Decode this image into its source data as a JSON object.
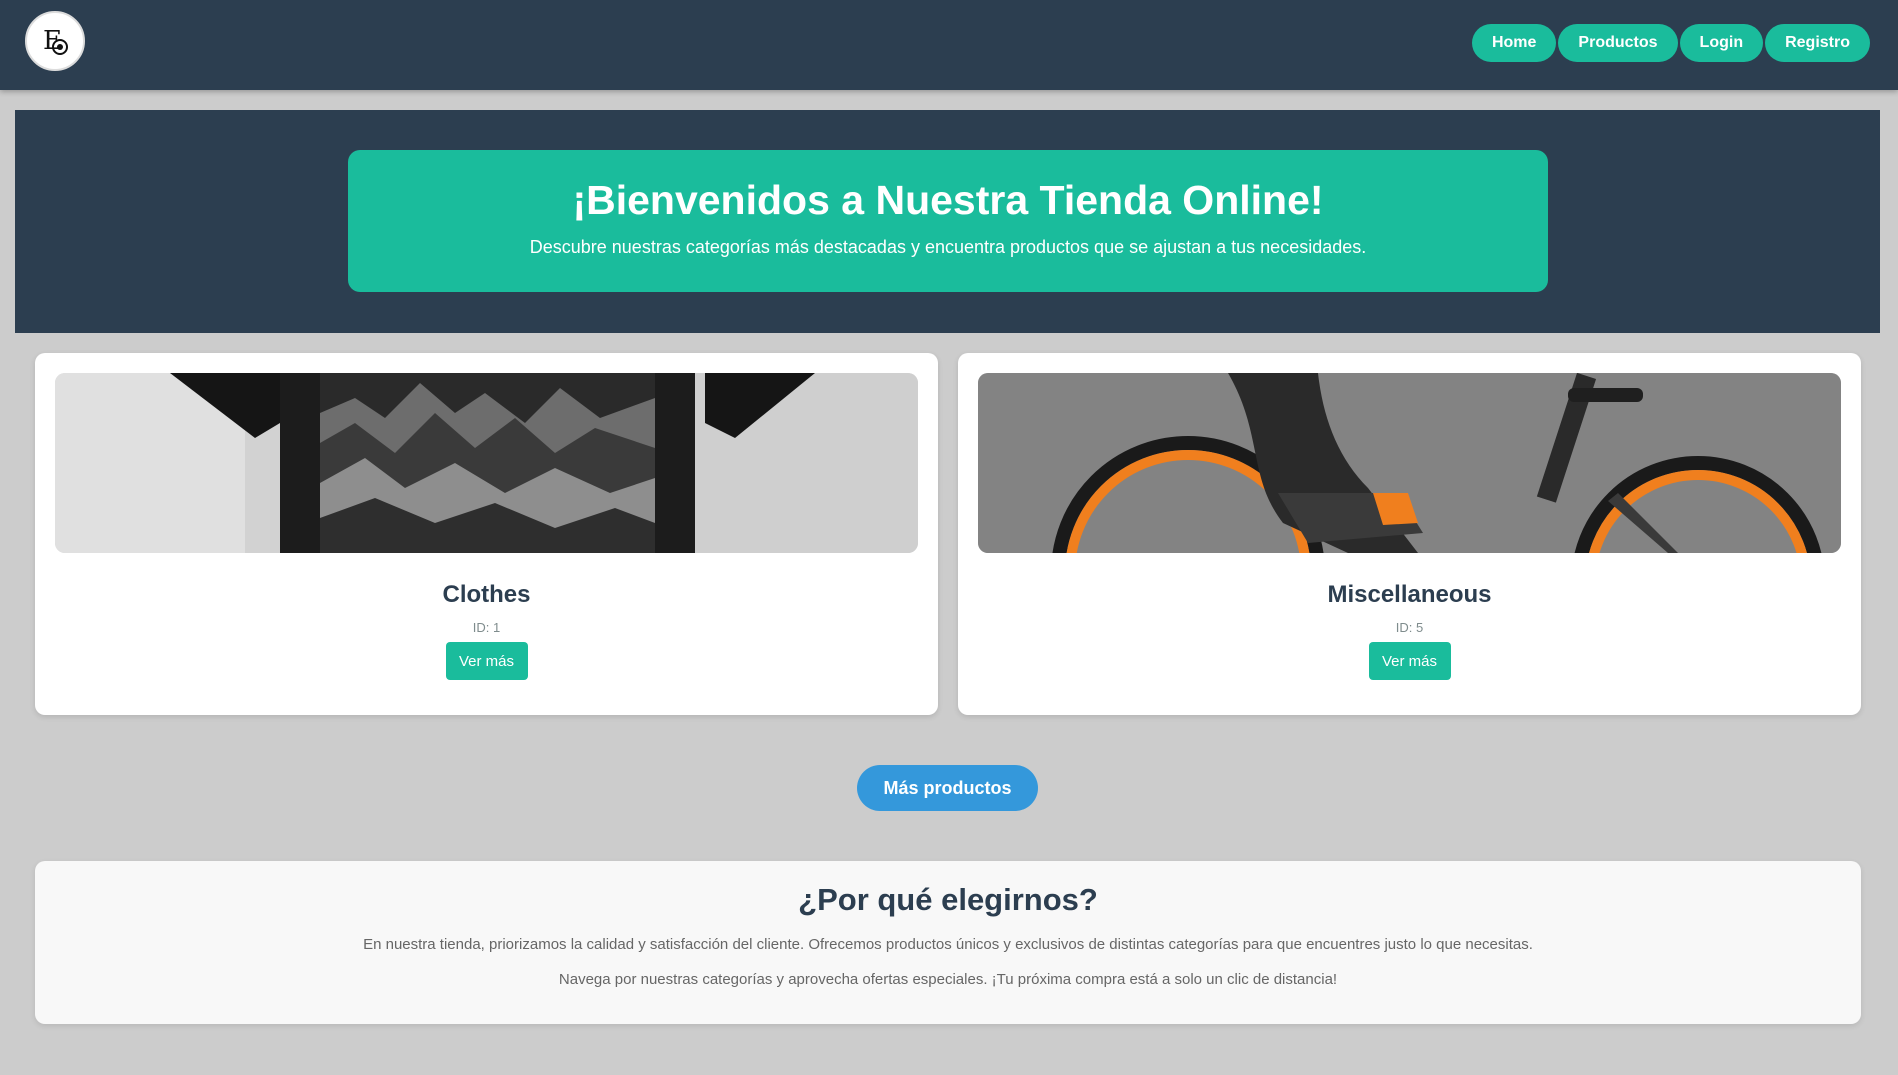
{
  "nav": {
    "logo_text": "E",
    "links": [
      "Home",
      "Productos",
      "Login",
      "Registro"
    ]
  },
  "hero": {
    "title": "¡Bienvenidos a Nuestra Tienda Online!",
    "subtitle": "Descubre nuestras categorías más destacadas y encuentra productos que se ajustan a tus necesidades."
  },
  "categories": [
    {
      "name": "Clothes",
      "id": "ID: 1",
      "button": "Ver más"
    },
    {
      "name": "Miscellaneous",
      "id": "ID: 5",
      "button": "Ver más"
    }
  ],
  "more_button": "Más productos",
  "why": {
    "title": "¿Por qué elegirnos?",
    "p1": "En nuestra tienda, priorizamos la calidad y satisfacción del cliente. Ofrecemos productos únicos y exclusivos de distintas categorías para que encuentres justo lo que necesitas.",
    "p2": "Navega por nuestras categorías y aprovecha ofertas especiales. ¡Tu próxima compra está a solo un clic de distancia!"
  },
  "colors": {
    "navy": "#2c3e50",
    "teal": "#1abc9c",
    "blue": "#3498db",
    "page_bg": "#cccccc"
  }
}
